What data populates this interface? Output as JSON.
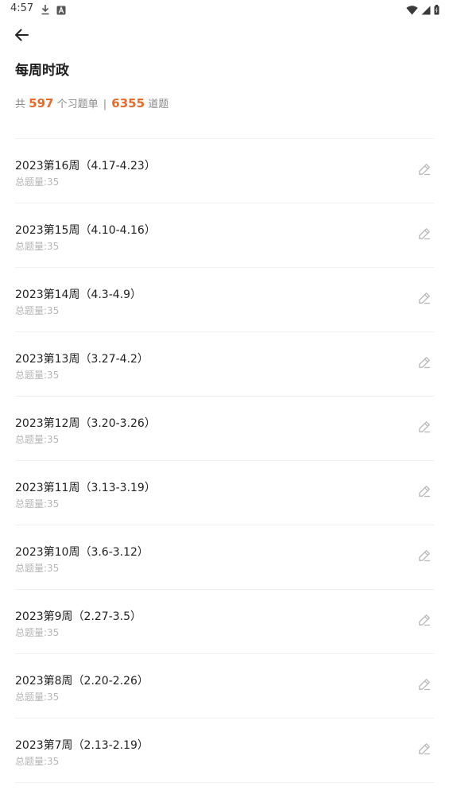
{
  "status_bar": {
    "time": "4:57",
    "icons": [
      "download-icon",
      "notification-a-icon",
      "wifi-icon",
      "signal-icon",
      "battery-icon"
    ]
  },
  "header": {
    "title": "每周时政"
  },
  "summary": {
    "prefix": "共",
    "sheet_count": "597",
    "sheet_unit": "个习题单",
    "separator": "|",
    "question_count": "6355",
    "question_unit": "道题"
  },
  "colors": {
    "accent": "#e86a28",
    "subtext": "#b5b5b5",
    "divider": "#efefef"
  },
  "items": [
    {
      "title": "2023第16周（4.17-4.23）",
      "subtitle": "总题量:35"
    },
    {
      "title": "2023第15周（4.10-4.16）",
      "subtitle": "总题量:35"
    },
    {
      "title": "2023第14周（4.3-4.9）",
      "subtitle": "总题量:35"
    },
    {
      "title": "2023第13周（3.27-4.2）",
      "subtitle": "总题量:35"
    },
    {
      "title": "2023第12周（3.20-3.26）",
      "subtitle": "总题量:35"
    },
    {
      "title": "2023第11周（3.13-3.19）",
      "subtitle": "总题量:35"
    },
    {
      "title": "2023第10周（3.6-3.12）",
      "subtitle": "总题量:35"
    },
    {
      "title": "2023第9周（2.27-3.5）",
      "subtitle": "总题量:35"
    },
    {
      "title": "2023第8周（2.20-2.26）",
      "subtitle": "总题量:35"
    },
    {
      "title": "2023第7周（2.13-2.19）",
      "subtitle": "总题量:35"
    }
  ]
}
